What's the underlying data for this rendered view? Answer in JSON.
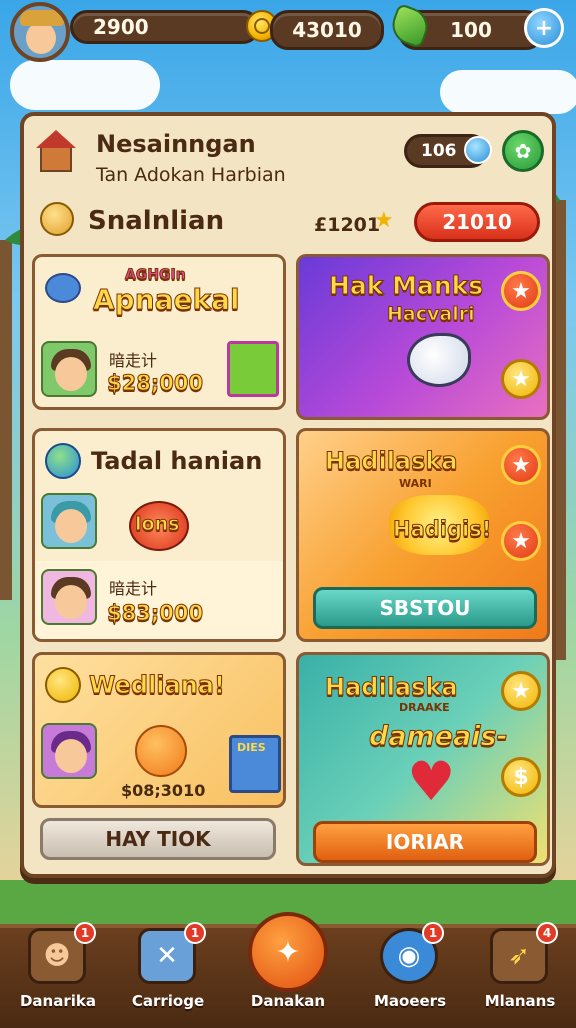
{
  "top_bar": {
    "coins_value": "2900",
    "gold_value": "43010",
    "gems_value": "100",
    "add_icon": "plus-icon"
  },
  "panel": {
    "header_title": "Nesainngan",
    "header_subtitle": "Tan Adokan Harbian",
    "header_count": "106",
    "section_title": "Snalnlian",
    "section_score": "£1201",
    "section_button": "21010"
  },
  "cards": {
    "card1": {
      "logo_text": "Apnaekal",
      "logo_top": "AGHGIn",
      "label": "暗走计",
      "price": "$28;000"
    },
    "card2": {
      "title": "Hak Manks",
      "subtitle": "Hacvalri"
    },
    "card3": {
      "title": "Tadal hanian",
      "badge": "lons",
      "label": "暗走计",
      "price": "$83;000"
    },
    "card4": {
      "title": "Hadilaska",
      "small": "WARI",
      "burst": "Hadigis!",
      "button": "SBSTOU"
    },
    "card5": {
      "title": "Wedliana!",
      "box_label": "DIES",
      "price": "$08;3010",
      "button": "HAY TIOK"
    },
    "card6": {
      "title": "Hadilaska",
      "small": "DRAAKE",
      "script": "dameais-",
      "button": "IORIAR"
    }
  },
  "nav": [
    {
      "label": "Danarika",
      "badge": "1",
      "icon": "character-icon"
    },
    {
      "label": "Carrioge",
      "badge": "1",
      "icon": "map-icon"
    },
    {
      "label": "Danakan",
      "badge": "",
      "icon": "battle-icon"
    },
    {
      "label": "Maoeers",
      "badge": "1",
      "icon": "camera-icon"
    },
    {
      "label": "Mlanans",
      "badge": "4",
      "icon": "rocket-icon"
    }
  ],
  "colors": {
    "panel_bg": "#f3e4c4",
    "frame_brown": "#6e4424",
    "accent_red": "#e03b14",
    "accent_gold": "#f0b400",
    "teal_button": "#3fb9a8",
    "orange_button": "#f07a1a"
  }
}
